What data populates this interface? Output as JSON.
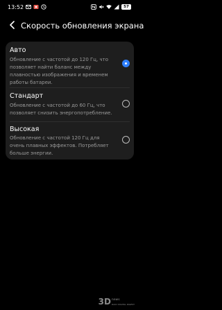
{
  "status_bar": {
    "time": "13:52",
    "battery": "57",
    "left_icons": [
      "email-icon",
      "photo-icon",
      "vpn-icon"
    ],
    "right_icons": [
      "nfc-icon",
      "mute-icon",
      "wifi-icon",
      "signal-icon",
      "battery-icon"
    ]
  },
  "header": {
    "back_icon": "chevron-left-icon",
    "title": "Скорость обновления экрана"
  },
  "options": [
    {
      "title": "Авто",
      "description": "Обновление с частотой до 120 Гц, что позволяет найти баланс между плавностью изображения и временем работы батареи.",
      "selected": true
    },
    {
      "title": "Стандарт",
      "description": "Обновление с частотой до 60 Гц, что позволяет снизить энергопотребление.",
      "selected": false
    },
    {
      "title": "Высокая",
      "description": "Обновление с частотой 120 Гц для очень плавных эффектов. Потребляет больше энергии.",
      "selected": false
    }
  ],
  "watermark": {
    "main": "3D",
    "sub1": "news",
    "sub2": "DAILY DIGITAL DIGEST"
  },
  "colors": {
    "background": "#000000",
    "card": "#1e1e1e",
    "accent": "#2f80ff",
    "secondary_text": "#9a9a9a"
  }
}
